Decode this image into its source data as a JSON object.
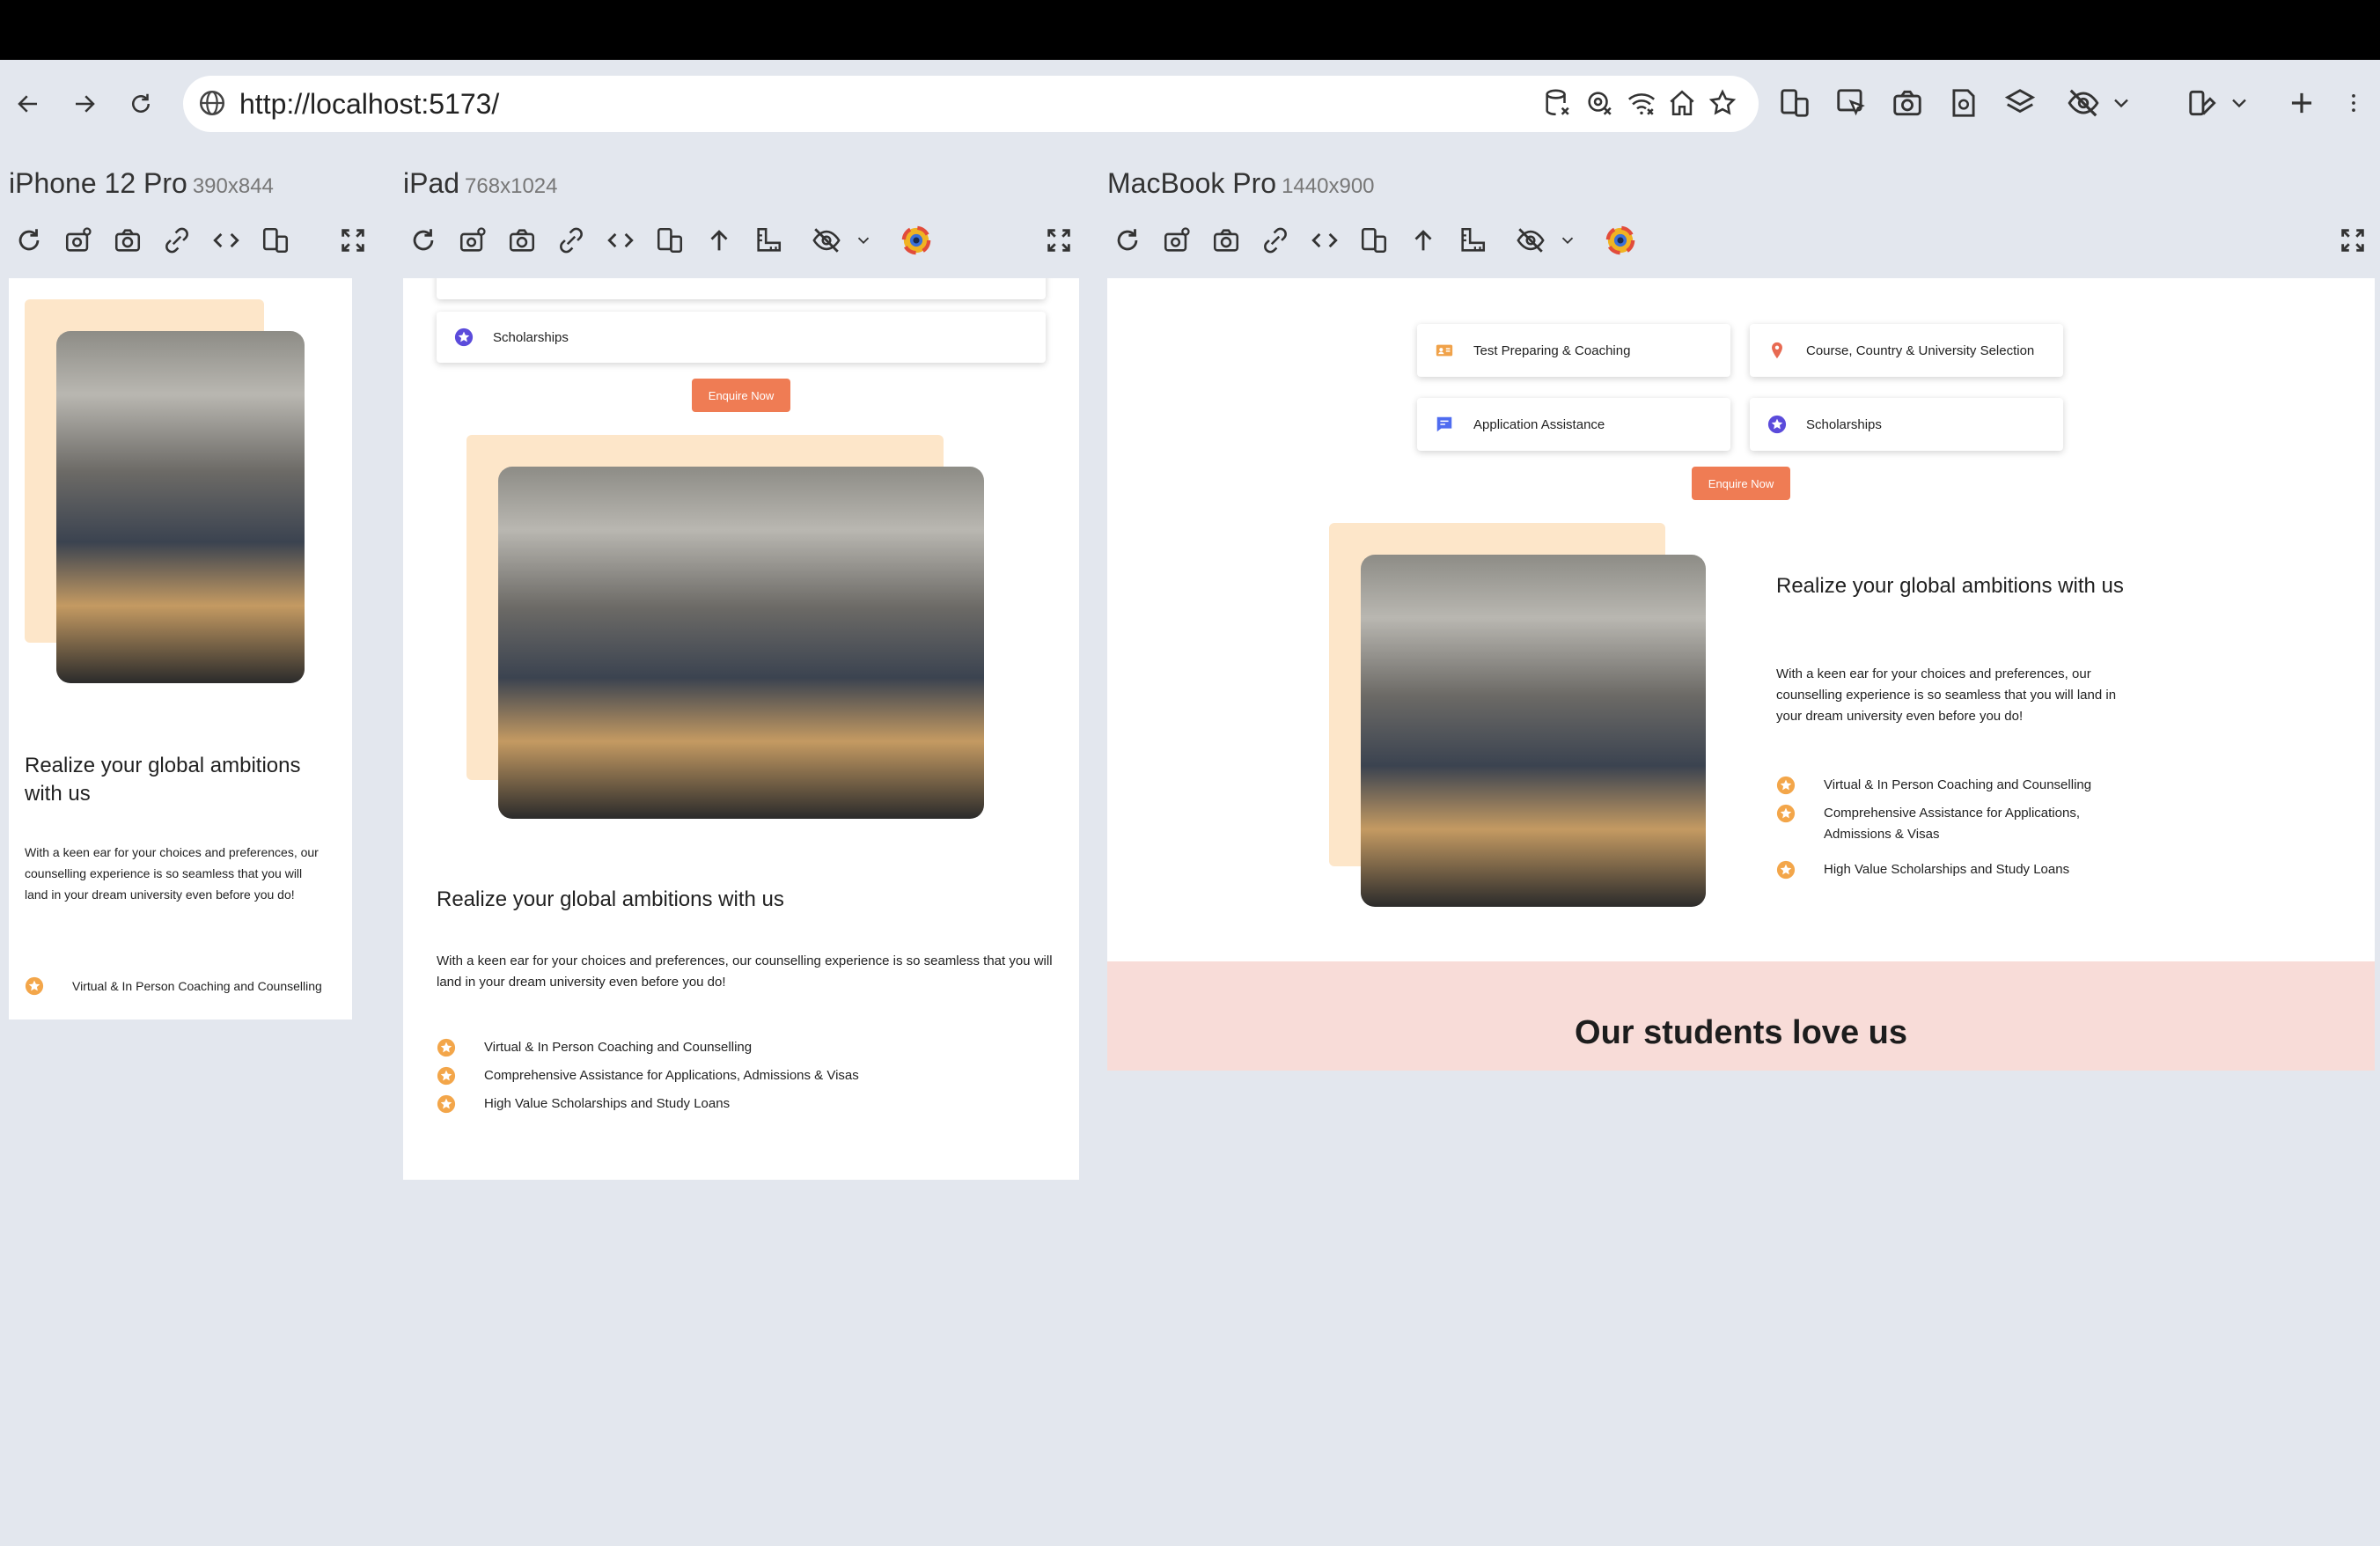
{
  "browser": {
    "url": "http://localhost:5173/"
  },
  "devices": [
    {
      "name": "iPhone 12 Pro",
      "dimensions": "390x844"
    },
    {
      "name": "iPad",
      "dimensions": "768x1024"
    },
    {
      "name": "MacBook Pro",
      "dimensions": "1440x900"
    }
  ],
  "services": [
    {
      "label": "Test Preparing & Coaching",
      "icon": "id-card-icon",
      "color": "#f0a24a"
    },
    {
      "label": "Course, Country & University Selection",
      "icon": "map-pin-icon",
      "color": "#e86a52"
    },
    {
      "label": "Application Assistance",
      "icon": "chat-icon",
      "color": "#4f6cf0"
    },
    {
      "label": "Scholarships",
      "icon": "star-badge-icon",
      "color": "#5b4bdb"
    }
  ],
  "enquire_label": "Enquire Now",
  "section": {
    "heading": "Realize your global ambitions with us",
    "paragraph": "With a keen ear for your choices and preferences, our counselling experience is so seamless that you will land in your dream university even before you do!",
    "features": [
      "Virtual & In Person Coaching and Counselling",
      "Comprehensive Assistance for Applications, Admissions & Visas",
      "High Value Scholarships and Study Loans"
    ]
  },
  "students_title": "Our students love us",
  "colors": {
    "accent": "#ef7c54",
    "photo_backdrop": "#fde6c9",
    "star": "#f3a64a",
    "students_bg": "#f8dcd8"
  }
}
